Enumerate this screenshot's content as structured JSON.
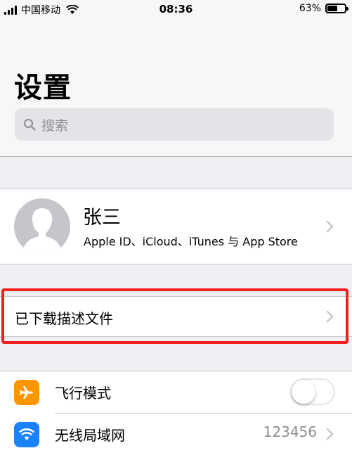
{
  "status_bar": {
    "carrier": "中国移动",
    "time": "08:36",
    "battery_pct": "63%",
    "battery_level": 0.63
  },
  "header": {
    "title": "设置",
    "search_placeholder": "搜索"
  },
  "profile": {
    "name": "张三",
    "subtitle": "Apple ID、iCloud、iTunes 与 App Store"
  },
  "profiles_row": {
    "label": "已下载描述文件"
  },
  "highlight_color": "#f5201b",
  "settings": [
    {
      "label": "飞行模式",
      "icon": "airplane-icon",
      "icon_color": "#ff9500",
      "toggle_on": false
    },
    {
      "label": "无线局域网",
      "icon": "wifi-icon",
      "icon_color": "#1a82fb",
      "value": "123456"
    }
  ]
}
